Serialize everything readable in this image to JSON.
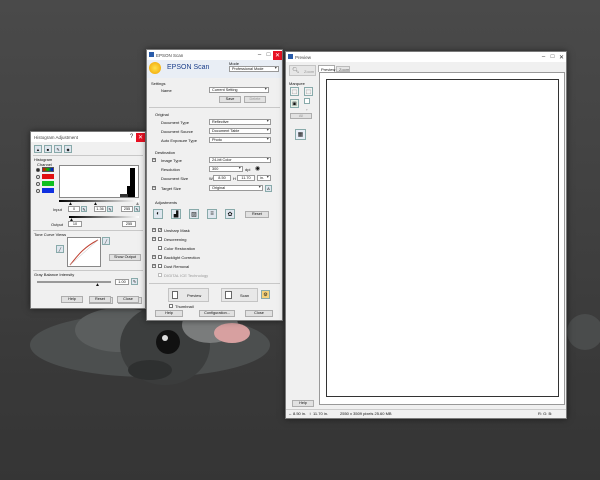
{
  "colors": {
    "accent": "#1e6fd9",
    "close_red": "#e81123",
    "epson_orange": "#f0a000",
    "panel": "#f0f0f0"
  },
  "histogram": {
    "title": "Histogram Adjustment",
    "section_histogram": "Histogram",
    "channel_label": "Channel",
    "input_label": "Input",
    "input_values": [
      "0",
      "1.36",
      "255"
    ],
    "output_label": "Output",
    "output_values": [
      "10",
      "255"
    ],
    "tone_curve_label": "Tone Curve Views",
    "show_output_label": "Show Output",
    "gray_balance_label": "Gray Balance Intensity",
    "gray_balance_value": "1.00",
    "buttons": {
      "help": "Help",
      "reset": "Reset",
      "close": "Close"
    }
  },
  "epson": {
    "window_title": "EPSON Scan",
    "app_name": "EPSON Scan",
    "mode_label": "Mode",
    "mode_value": "Professional Mode",
    "settings_label": "Settings",
    "name_label": "Name",
    "name_value": "Current Setting",
    "save_label": "Save",
    "delete_label": "Delete",
    "original_label": "Original",
    "doc_type_label": "Document Type",
    "doc_type_value": "Reflective",
    "doc_source_label": "Document Source",
    "doc_source_value": "Document Table",
    "auto_exposure_label": "Auto Exposure Type",
    "auto_exposure_value": "Photo",
    "destination_label": "Destination",
    "image_type_label": "Image Type",
    "image_type_value": "24-bit Color",
    "resolution_label": "Resolution",
    "resolution_value": "300",
    "resolution_unit": "dpi",
    "doc_size_label": "Document Size",
    "doc_size_w_label": "W",
    "doc_size_w": "8.50",
    "doc_size_h_label": "H",
    "doc_size_h": "11.70",
    "doc_size_unit": "in.",
    "target_size_label": "Target Size",
    "target_size_value": "Original",
    "adjustments_label": "Adjustments",
    "reset_label": "Reset",
    "options": [
      {
        "label": "Unsharp Mask",
        "checked": true
      },
      {
        "label": "Descreening",
        "checked": false
      },
      {
        "label": "Color Restoration",
        "checked": false
      },
      {
        "label": "Backlight Correction",
        "checked": false
      },
      {
        "label": "Dust Removal",
        "checked": false
      },
      {
        "label": "DIGITAL ICE Technology",
        "checked": false
      }
    ],
    "preview_btn": "Preview",
    "scan_btn": "Scan",
    "thumbnail_label": "Thumbnail",
    "help_btn": "Help",
    "configuration_btn": "Configuration...",
    "close_btn": "Close"
  },
  "preview": {
    "window_title": "Preview",
    "zoom_label": "Zoom",
    "tab_preview": "Preview",
    "tab_zoom": "Zoom",
    "marquee_label": "Marquee",
    "all_label": "All",
    "help_btn": "Help",
    "status_size": "8.50 in.",
    "status_h": "11.70 in.",
    "status_pixels": "2550 x 3509 pixels 25.60 MB",
    "status_rgb": "R:  G:  B:"
  }
}
